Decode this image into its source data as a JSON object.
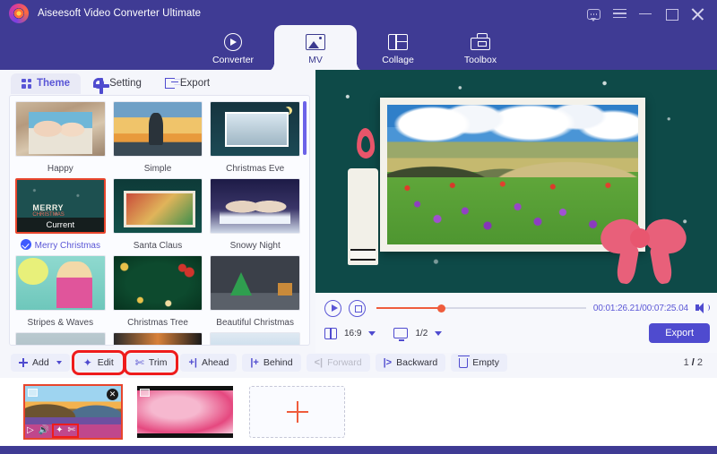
{
  "window": {
    "title": "Aiseesoft Video Converter Ultimate",
    "controls": [
      {
        "name": "feedback-icon",
        "label": ""
      },
      {
        "name": "menu-icon",
        "label": ""
      },
      {
        "name": "minimize-icon",
        "label": ""
      },
      {
        "name": "maximize-icon",
        "label": ""
      },
      {
        "name": "close-icon",
        "label": ""
      }
    ],
    "accent": "#4f4bcf",
    "header_bg": "#3f3b94"
  },
  "nav": {
    "tabs": [
      {
        "label": "Converter",
        "icon": "converter-icon",
        "active": false
      },
      {
        "label": "MV",
        "icon": "mv-icon",
        "active": true
      },
      {
        "label": "Collage",
        "icon": "collage-icon",
        "active": false
      },
      {
        "label": "Toolbox",
        "icon": "toolbox-icon",
        "active": false
      }
    ]
  },
  "subtabs": [
    {
      "label": "Theme",
      "icon": "grid-icon",
      "active": true
    },
    {
      "label": "Setting",
      "icon": "gear-icon",
      "active": false
    },
    {
      "label": "Export",
      "icon": "export-icon",
      "active": false
    }
  ],
  "themes": [
    {
      "name": "Happy",
      "selected": false,
      "art": "t-happy"
    },
    {
      "name": "Simple",
      "selected": false,
      "art": "t-simple"
    },
    {
      "name": "Christmas Eve",
      "selected": false,
      "art": "t-xmaseve"
    },
    {
      "name": "Merry Christmas",
      "selected": true,
      "art": "t-merry",
      "badge": "Current"
    },
    {
      "name": "Santa Claus",
      "selected": false,
      "art": "t-santa"
    },
    {
      "name": "Snowy Night",
      "selected": false,
      "art": "t-snowy"
    },
    {
      "name": "Stripes & Waves",
      "selected": false,
      "art": "t-stripes"
    },
    {
      "name": "Christmas Tree",
      "selected": false,
      "art": "t-xtree"
    },
    {
      "name": "Beautiful Christmas",
      "selected": false,
      "art": "t-beaut"
    }
  ],
  "theme_extra": {
    "current_badge": "Current",
    "merry_title": "MERRY",
    "merry_sub": "CHRISTMAS"
  },
  "player": {
    "time": "00:01:26.21/00:07:25.04",
    "progress_percent": 31,
    "aspect_ratio": "16:9",
    "zoom": "1/2",
    "export_label": "Export",
    "play_icon": "play-icon",
    "stop_icon": "stop-icon",
    "volume_icon": "volume-icon",
    "ratio_icon": "aspect-ratio-icon",
    "monitor_icon": "monitor-icon"
  },
  "toolbar": {
    "buttons": [
      {
        "label": "Add",
        "icon": "plus-icon",
        "caret": true,
        "disabled": false,
        "highlight": false
      },
      {
        "label": "Edit",
        "icon": "magic-wand-icon",
        "caret": false,
        "disabled": false,
        "highlight": true
      },
      {
        "label": "Trim",
        "icon": "scissors-icon",
        "caret": false,
        "disabled": false,
        "highlight": true
      },
      {
        "label": "Ahead",
        "icon": "move-ahead-icon",
        "caret": false,
        "disabled": false,
        "highlight": false
      },
      {
        "label": "Behind",
        "icon": "move-behind-icon",
        "caret": false,
        "disabled": false,
        "highlight": false
      },
      {
        "label": "Forward",
        "icon": "forward-icon",
        "caret": false,
        "disabled": true,
        "highlight": false
      },
      {
        "label": "Backward",
        "icon": "backward-icon",
        "caret": false,
        "disabled": false,
        "highlight": false
      },
      {
        "label": "Empty",
        "icon": "trash-icon",
        "caret": false,
        "disabled": false,
        "highlight": false
      }
    ],
    "page_current": "1",
    "page_sep": "/",
    "page_total": "2"
  },
  "clips": [
    {
      "name": "clip-sunset-mountains",
      "selected": true,
      "remove_icon": "close-icon",
      "tools": [
        "play-icon",
        "volume-icon",
        "magic-wand-icon",
        "scissors-icon"
      ]
    },
    {
      "name": "clip-pink-texture",
      "selected": false
    }
  ],
  "add_clip": {
    "label": "+",
    "name": "add-clip-button"
  }
}
